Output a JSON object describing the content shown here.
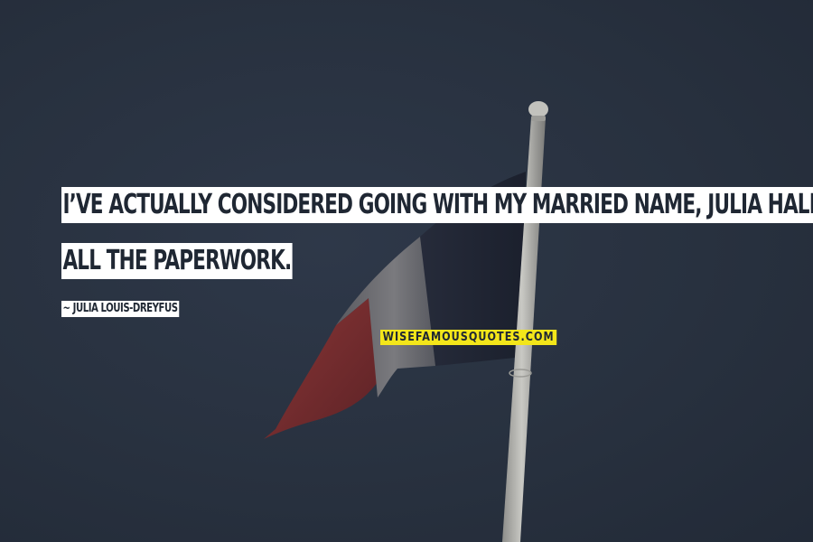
{
  "quote": {
    "line_1": "I’ve actually considered going with my married name, Julia Hall, but",
    "line_2": "all the paperwork."
  },
  "author": {
    "text": "~ Julia Louis-Dreyfus"
  },
  "watermark": {
    "text": "WISEFAMOUSQUOTES.COM"
  },
  "colors": {
    "background": "#27303f",
    "quote_box": "#ffffff",
    "quote_text": "#1f2733",
    "watermark_box": "#f3e61a",
    "flag_blue": "#1f2433",
    "flag_white": "#6a6a6e",
    "flag_red": "#7a2e2e",
    "pole": "#b9b9b4"
  },
  "icons": {
    "scene": "flag-on-pole-image"
  }
}
